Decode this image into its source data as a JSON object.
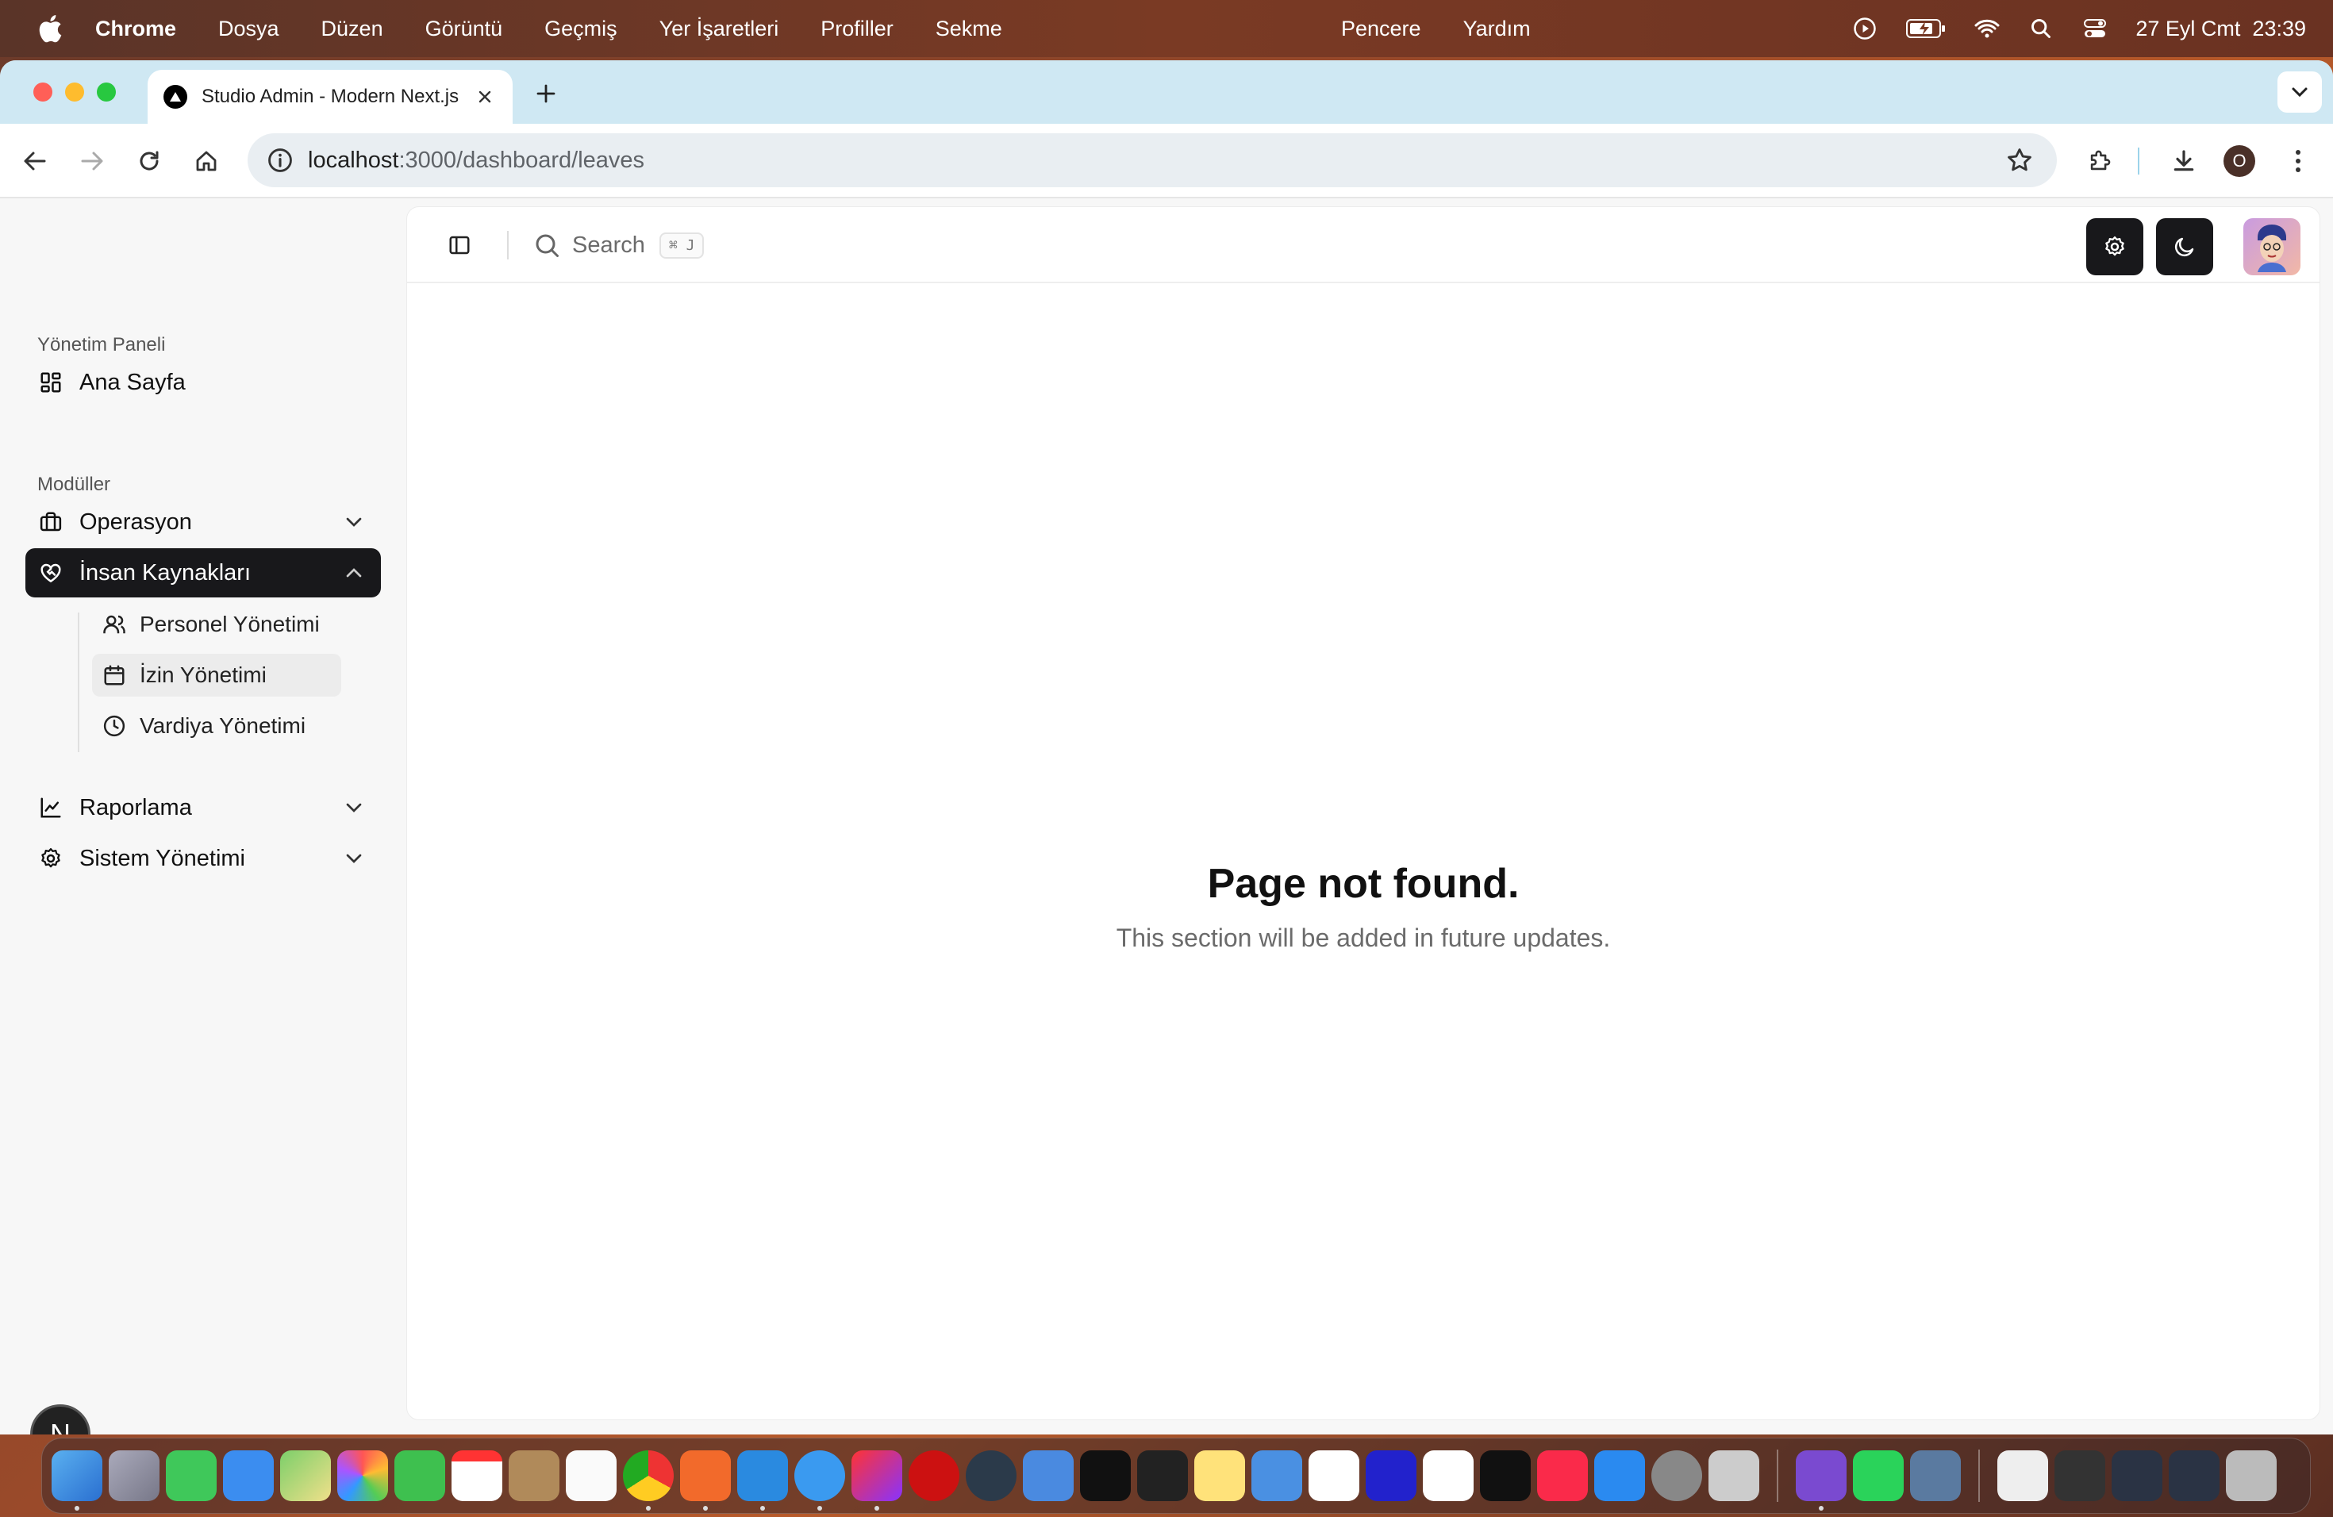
{
  "menubar": {
    "app_name": "Chrome",
    "items": [
      "Dosya",
      "Düzen",
      "Görüntü",
      "Geçmiş",
      "Yer İşaretleri",
      "Profiller",
      "Sekme"
    ],
    "center_items": [
      "Pencere",
      "Yardım"
    ],
    "clock": "27 Eyl Cmt  23:39"
  },
  "browser": {
    "tab_title": "Studio Admin - Modern Next.js",
    "url_host": "localhost",
    "url_path": ":3000/dashboard/leaves",
    "profile_initial": "O"
  },
  "sidebar": {
    "group_dashboard": "Yönetim Paneli",
    "home_label": "Ana Sayfa",
    "group_modules": "Modüller",
    "operations_label": "Operasyon",
    "hr_label": "İnsan Kaynakları",
    "hr_sub": [
      "Personel Yönetimi",
      "İzin Yönetimi",
      "Vardiya Yönetimi"
    ],
    "reporting_label": "Raporlama",
    "system_label": "Sistem Yönetimi"
  },
  "topbar": {
    "search_placeholder": "Search",
    "search_shortcut": "⌘ J"
  },
  "content": {
    "title": "Page not found.",
    "subtitle": "This section will be added in future updates."
  },
  "next_badge": "N",
  "colors": {
    "accent_dark": "#18181b",
    "tabbar": "#cfe8f3",
    "page_bg": "#f7f7f7"
  }
}
